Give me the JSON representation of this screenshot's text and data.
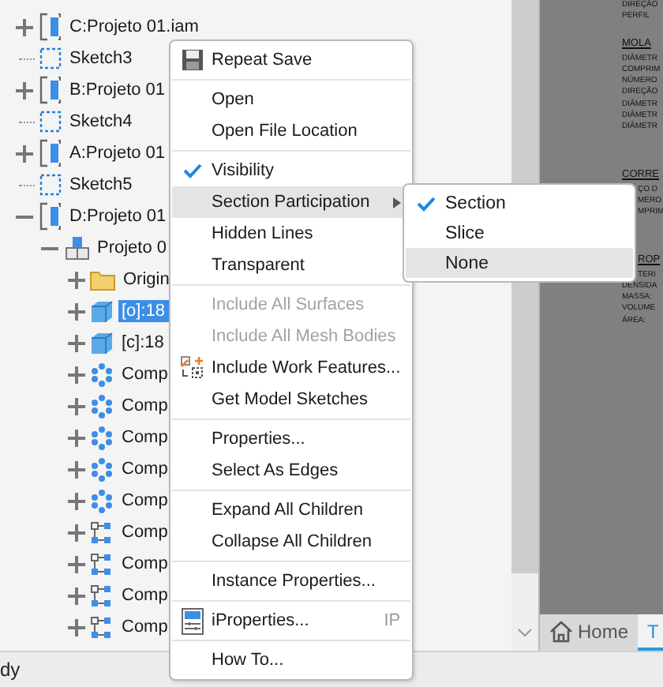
{
  "browser": {
    "tree": [
      {
        "label": "C:Projeto 01.iam",
        "kind": "assembly",
        "expanded": false,
        "selected": false
      },
      {
        "label": "Sketch3",
        "kind": "sketch",
        "selected": false
      },
      {
        "label": "B:Projeto 01",
        "kind": "assembly",
        "expanded": false,
        "selected": false
      },
      {
        "label": "Sketch4",
        "kind": "sketch",
        "selected": false
      },
      {
        "label": "A:Projeto 01",
        "kind": "assembly",
        "expanded": false,
        "selected": false
      },
      {
        "label": "Sketch5",
        "kind": "sketch",
        "selected": false
      },
      {
        "label": "D:Projeto 01",
        "kind": "assembly",
        "expanded": true,
        "selected": false,
        "children": [
          {
            "label": "Projeto 0",
            "kind": "part",
            "expanded": true,
            "selected": false,
            "children": [
              {
                "label": "Origin",
                "kind": "folder",
                "expanded": false,
                "selected": false
              },
              {
                "label": "[o]:18",
                "kind": "body",
                "expanded": false,
                "selected": true
              },
              {
                "label": "[c]:18",
                "kind": "body",
                "expanded": false,
                "selected": false
              },
              {
                "label": "Comp",
                "kind": "pattern",
                "expanded": false,
                "selected": false
              },
              {
                "label": "Comp",
                "kind": "pattern",
                "expanded": false,
                "selected": false
              },
              {
                "label": "Comp",
                "kind": "pattern",
                "expanded": false,
                "selected": false
              },
              {
                "label": "Comp",
                "kind": "pattern",
                "expanded": false,
                "selected": false
              },
              {
                "label": "Comp",
                "kind": "pattern",
                "expanded": false,
                "selected": false
              },
              {
                "label": "Comp",
                "kind": "component",
                "expanded": false,
                "selected": false
              },
              {
                "label": "Comp",
                "kind": "component",
                "expanded": false,
                "selected": false
              },
              {
                "label": "Comp",
                "kind": "component",
                "expanded": false,
                "selected": false
              },
              {
                "label": "Comp",
                "kind": "component",
                "expanded": false,
                "selected": false
              }
            ]
          }
        ]
      }
    ]
  },
  "context_menu": {
    "groups": [
      [
        {
          "label": "Repeat Save",
          "kind": "save",
          "checked": false,
          "disabled": false,
          "selected": false
        }
      ],
      [
        {
          "label": "Open",
          "kind": "plain",
          "checked": false,
          "disabled": false,
          "selected": false
        },
        {
          "label": "Open File Location",
          "kind": "plain",
          "checked": false,
          "disabled": false,
          "selected": false
        }
      ],
      [
        {
          "label": "Visibility",
          "kind": "plain",
          "checked": true,
          "disabled": false,
          "selected": false
        },
        {
          "label": "Section Participation",
          "kind": "submenu",
          "checked": false,
          "disabled": false,
          "selected": true
        },
        {
          "label": "Hidden Lines",
          "kind": "plain",
          "checked": false,
          "disabled": false,
          "selected": false
        },
        {
          "label": "Transparent",
          "kind": "plain",
          "checked": false,
          "disabled": false,
          "selected": false
        }
      ],
      [
        {
          "label": "Include All Surfaces",
          "kind": "plain",
          "checked": false,
          "disabled": true,
          "selected": false
        },
        {
          "label": "Include All Mesh Bodies",
          "kind": "plain",
          "checked": false,
          "disabled": true,
          "selected": false
        },
        {
          "label": "Include Work Features...",
          "kind": "work-features",
          "checked": false,
          "disabled": false,
          "selected": false
        },
        {
          "label": "Get Model Sketches",
          "kind": "plain",
          "checked": false,
          "disabled": false,
          "selected": false
        }
      ],
      [
        {
          "label": "Properties...",
          "kind": "plain",
          "checked": false,
          "disabled": false,
          "selected": false
        },
        {
          "label": "Select As Edges",
          "kind": "plain",
          "checked": false,
          "disabled": false,
          "selected": false
        }
      ],
      [
        {
          "label": "Expand All Children",
          "kind": "plain",
          "checked": false,
          "disabled": false,
          "selected": false
        },
        {
          "label": "Collapse All Children",
          "kind": "plain",
          "checked": false,
          "disabled": false,
          "selected": false
        }
      ],
      [
        {
          "label": "Instance Properties...",
          "kind": "plain",
          "checked": false,
          "disabled": false,
          "selected": false
        }
      ],
      [
        {
          "label": "iProperties...",
          "kind": "iproperties",
          "shortcut": "IP",
          "checked": false,
          "disabled": false,
          "selected": false
        }
      ],
      [
        {
          "label": "How To...",
          "kind": "plain",
          "checked": false,
          "disabled": false,
          "selected": false
        }
      ]
    ]
  },
  "submenu": {
    "items": [
      {
        "label": "Section",
        "checked": true,
        "selected": false
      },
      {
        "label": "Slice",
        "checked": false,
        "selected": false
      },
      {
        "label": "None",
        "checked": false,
        "selected": true
      }
    ]
  },
  "drawing": {
    "lines": [
      {
        "text": "DIREÇÃO",
        "kind": "line"
      },
      {
        "text": "PERFIL",
        "kind": "line"
      },
      {
        "text": "MOLA",
        "kind": "heading"
      },
      {
        "text": "DIÂMETR",
        "kind": "line"
      },
      {
        "text": "COMPRIM",
        "kind": "line"
      },
      {
        "text": "NÚMERO",
        "kind": "line"
      },
      {
        "text": "DIREÇÃO",
        "kind": "line"
      },
      {
        "text": "DIÂMETR",
        "kind": "line"
      },
      {
        "text": "DIÂMETR",
        "kind": "line"
      },
      {
        "text": "DIÂMETR",
        "kind": "line"
      },
      {
        "text": "CORRE",
        "kind": "spaced-heading"
      },
      {
        "text": "ÇO D",
        "kind": "clipped"
      },
      {
        "text": "MERO",
        "kind": "clipped"
      },
      {
        "text": "MPRIM",
        "kind": "clipped"
      },
      {
        "text": "ROP",
        "kind": "clipped-heading"
      },
      {
        "text": "TERI",
        "kind": "clipped"
      },
      {
        "text": "DENSIDA",
        "kind": "line"
      },
      {
        "text": "MASSA:",
        "kind": "line"
      },
      {
        "text": "VOLUME",
        "kind": "line"
      },
      {
        "text": "ÁREA:",
        "kind": "line"
      }
    ]
  },
  "tabs": [
    {
      "label": "Home",
      "kind": "home",
      "selected": false
    },
    {
      "label": "T",
      "kind": "plain",
      "selected": true
    }
  ],
  "status_bar": {
    "text": "dy"
  }
}
